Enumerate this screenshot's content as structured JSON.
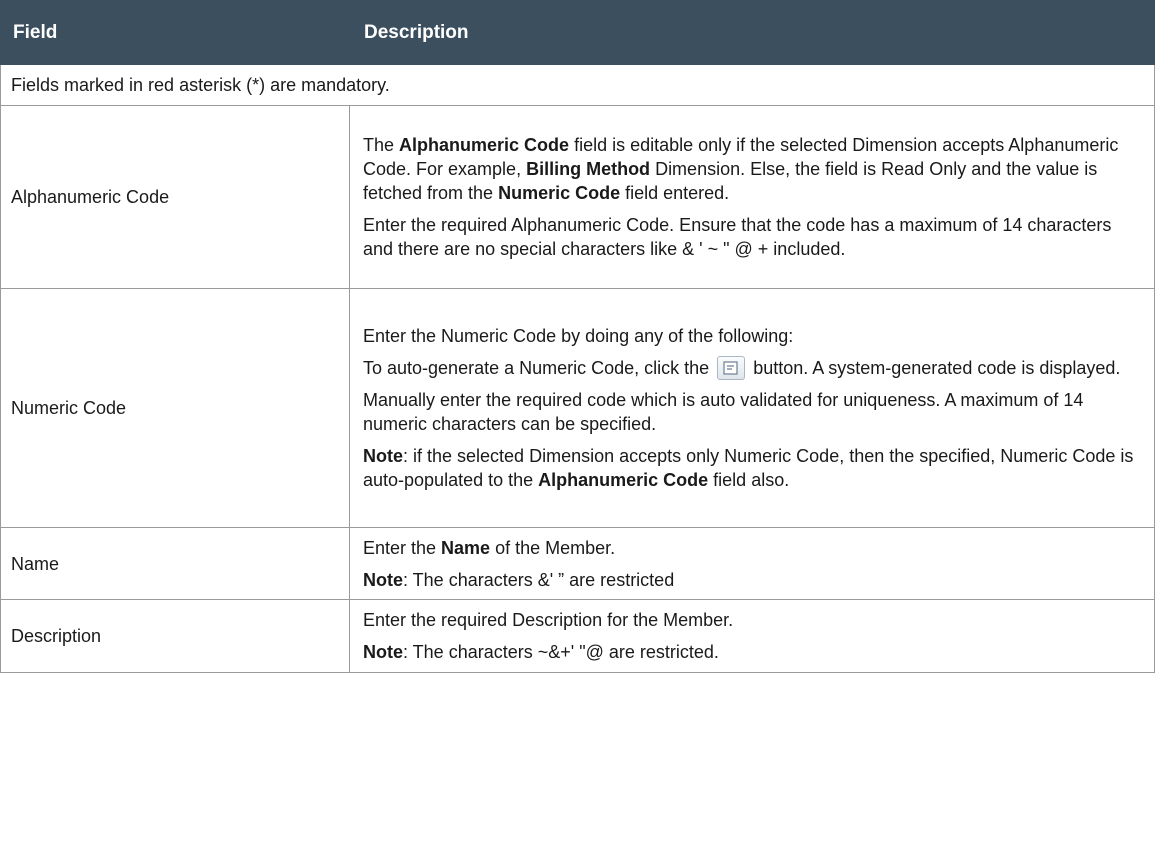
{
  "header": {
    "field": "Field",
    "description": "Description"
  },
  "notice": "Fields marked in red asterisk (*) are mandatory.",
  "rows": [
    {
      "field": "Alphanumeric Code",
      "paragraphs": [
        [
          {
            "t": "The ",
            "b": false
          },
          {
            "t": "Alphanumeric Code",
            "b": true
          },
          {
            "t": " field is editable only if the selected Dimension accepts Alphanumeric Code. For example, ",
            "b": false
          },
          {
            "t": "Billing Method",
            "b": true
          },
          {
            "t": " Dimension. Else, the field is Read Only and the value is fetched from the ",
            "b": false
          },
          {
            "t": "Numeric Code",
            "b": true
          },
          {
            "t": " field entered.",
            "b": false
          }
        ],
        [
          {
            "t": "Enter the required Alphanumeric Code. Ensure that the code has a maximum of 14 characters and there are no special characters like & ' ~ \" @ + included.",
            "b": false
          }
        ]
      ]
    },
    {
      "field": "Numeric Code",
      "paragraphs": [
        [
          {
            "t": "Enter the Numeric Code by doing any of the following:",
            "b": false
          }
        ],
        [
          {
            "t": "To auto-generate a Numeric Code, click the ",
            "b": false
          },
          {
            "icon": "auto-generate-icon"
          },
          {
            "t": " button. A system-generated code is displayed.",
            "b": false
          }
        ],
        [
          {
            "t": "Manually enter the required code which is auto validated for uniqueness. A maximum of 14 numeric characters can be specified.",
            "b": false
          }
        ],
        [
          {
            "t": "Note",
            "b": true
          },
          {
            "t": ": if the selected Dimension accepts only Numeric Code, then the specified, Numeric Code is auto-populated to the ",
            "b": false
          },
          {
            "t": "Alphanumeric Code",
            "b": true
          },
          {
            "t": " field also.",
            "b": false
          }
        ]
      ]
    },
    {
      "field": "Name",
      "paragraphs": [
        [
          {
            "t": "Enter the ",
            "b": false
          },
          {
            "t": "Name",
            "b": true
          },
          {
            "t": " of the Member.",
            "b": false
          }
        ],
        [
          {
            "t": "Note",
            "b": true
          },
          {
            "t": ": The characters &' ” are restricted",
            "b": false
          }
        ]
      ]
    },
    {
      "field": "Description",
      "paragraphs": [
        [
          {
            "t": "Enter the required Description for the Member.",
            "b": false
          }
        ],
        [
          {
            "t": "Note",
            "b": true
          },
          {
            "t": ": The characters ~&+' \"@ are restricted.",
            "b": false
          }
        ]
      ]
    }
  ],
  "colors": {
    "header_bg": "#3c4f5f",
    "header_text": "#ffffff",
    "border": "#9a9a9a"
  }
}
